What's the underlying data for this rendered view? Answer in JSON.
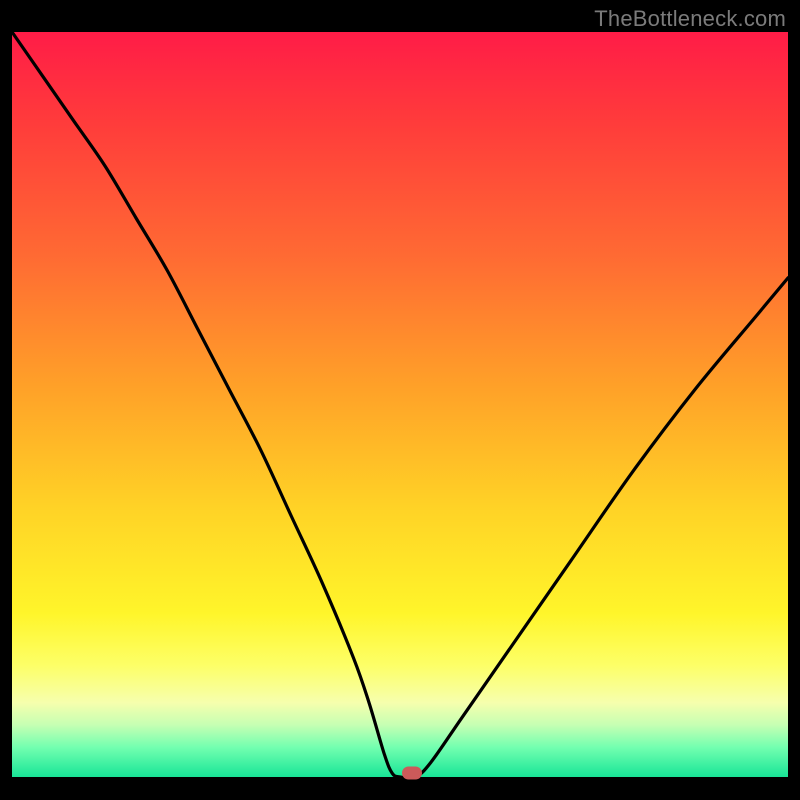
{
  "watermark": "TheBottleneck.com",
  "colors": {
    "page_bg": "#000000",
    "gradient_top": "#ff1c47",
    "gradient_bottom": "#18e597",
    "curve": "#000000",
    "marker": "#cc5a5a",
    "watermark": "#7b7b7b"
  },
  "chart_data": {
    "type": "line",
    "title": "",
    "xlabel": "",
    "ylabel": "",
    "xlim": [
      0,
      100
    ],
    "ylim": [
      0,
      100
    ],
    "grid": false,
    "series": [
      {
        "name": "bottleneck-curve",
        "x": [
          0,
          4,
          8,
          12,
          16,
          20,
          24,
          28,
          32,
          36,
          40,
          44,
          46,
          48,
          49,
          50,
          52,
          54,
          58,
          64,
          72,
          80,
          88,
          96,
          100
        ],
        "y": [
          100,
          94,
          88,
          82,
          75,
          68,
          60,
          52,
          44,
          35,
          26,
          16,
          10,
          3,
          0.5,
          0,
          0,
          2,
          8,
          17,
          29,
          41,
          52,
          62,
          67
        ]
      }
    ],
    "marker": {
      "x": 51.5,
      "y": 0.5
    },
    "flat_segment": {
      "x_start": 49,
      "x_end": 53,
      "y": 0
    }
  }
}
